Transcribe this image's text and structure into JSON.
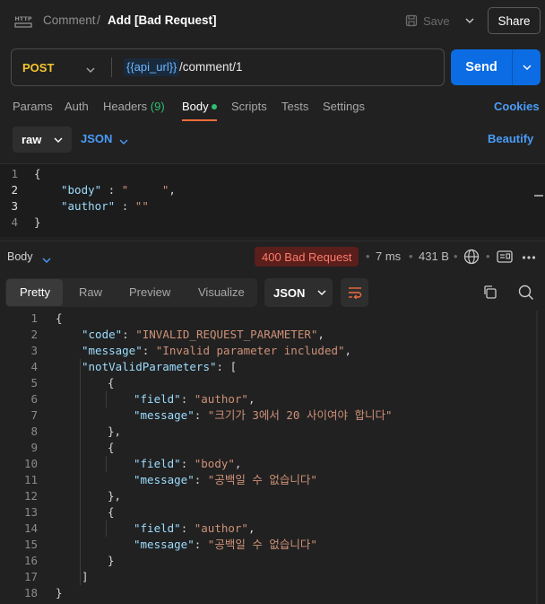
{
  "header": {
    "icon_text": "HTTP",
    "crumb_parent": "Comment",
    "crumb_sep": "/",
    "title": "Add [Bad Request]",
    "save_label": "Save",
    "share_label": "Share"
  },
  "url_bar": {
    "method": "POST",
    "variable": "{{api_url}}",
    "path": "/comment/1",
    "send_label": "Send"
  },
  "request_tabs": {
    "params": "Params",
    "auth": "Auth",
    "headers": "Headers",
    "headers_count": "(9)",
    "body": "Body",
    "scripts": "Scripts",
    "tests": "Tests",
    "settings": "Settings",
    "cookies": "Cookies"
  },
  "body_options": {
    "mode": "raw",
    "language": "JSON",
    "beautify": "Beautify"
  },
  "request_code": {
    "line_numbers": [
      "1",
      "2",
      "3",
      "4"
    ],
    "line1": "{",
    "body_key": "\"body\"",
    "body_sep": " : ",
    "body_val": "\"     \"",
    "body_tail": ",",
    "author_key": "\"author\"",
    "author_sep": " : ",
    "author_val": "\"\"",
    "line4": "}"
  },
  "response": {
    "label": "Body",
    "status": "400 Bad Request",
    "time": "7 ms",
    "size": "431 B",
    "dot": "•",
    "view_tabs": [
      "Pretty",
      "Raw",
      "Preview",
      "Visualize"
    ],
    "format": "JSON"
  },
  "response_code": {
    "line_numbers": [
      "1",
      "2",
      "3",
      "4",
      "5",
      "6",
      "7",
      "8",
      "9",
      "10",
      "11",
      "12",
      "13",
      "14",
      "15",
      "16",
      "17",
      "18"
    ],
    "code_key": "\"code\"",
    "code_val": "\"INVALID_REQUEST_PARAMETER\"",
    "message_key": "\"message\"",
    "message_val": "\"Invalid parameter included\"",
    "nvp_key": "\"notValidParameters\"",
    "field_key": "\"field\"",
    "item1_field": "\"author\"",
    "item1_message": "\"크기가 3에서 20 사이여야 합니다\"",
    "item2_field": "\"body\"",
    "item2_message": "\"공백일 수 없습니다\"",
    "item3_field": "\"author\"",
    "item3_message": "\"공백일 수 없습니다\""
  }
}
